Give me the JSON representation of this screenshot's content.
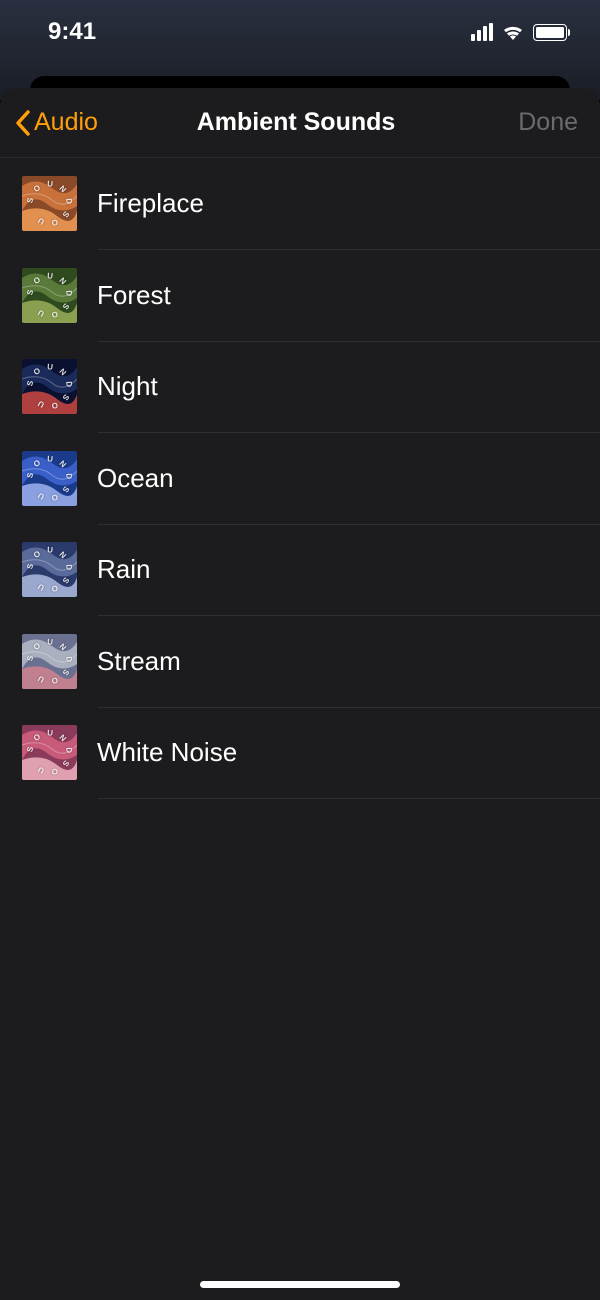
{
  "status": {
    "time": "9:41"
  },
  "nav": {
    "back_label": "Audio",
    "title": "Ambient Sounds",
    "done_label": "Done"
  },
  "sounds": [
    {
      "label": "Fireplace",
      "thumb_colors": [
        "#c9713a",
        "#8a4a2a",
        "#e29050"
      ],
      "icon": "fireplace-thumb"
    },
    {
      "label": "Forest",
      "thumb_colors": [
        "#5a7a3a",
        "#2e4a1e",
        "#8aa050"
      ],
      "icon": "forest-thumb"
    },
    {
      "label": "Night",
      "thumb_colors": [
        "#1a2a5a",
        "#0a1030",
        "#b04040"
      ],
      "icon": "night-thumb"
    },
    {
      "label": "Ocean",
      "thumb_colors": [
        "#3a5fc9",
        "#1a3a8a",
        "#8aa0e0"
      ],
      "icon": "ocean-thumb"
    },
    {
      "label": "Rain",
      "thumb_colors": [
        "#5a6a9a",
        "#2a3a6a",
        "#9aa8d0"
      ],
      "icon": "rain-thumb"
    },
    {
      "label": "Stream",
      "thumb_colors": [
        "#aab0c0",
        "#6a7090",
        "#c08090"
      ],
      "icon": "stream-thumb"
    },
    {
      "label": "White Noise",
      "thumb_colors": [
        "#c85a7a",
        "#8a3a5a",
        "#e0a0b0"
      ],
      "icon": "white-noise-thumb"
    }
  ]
}
